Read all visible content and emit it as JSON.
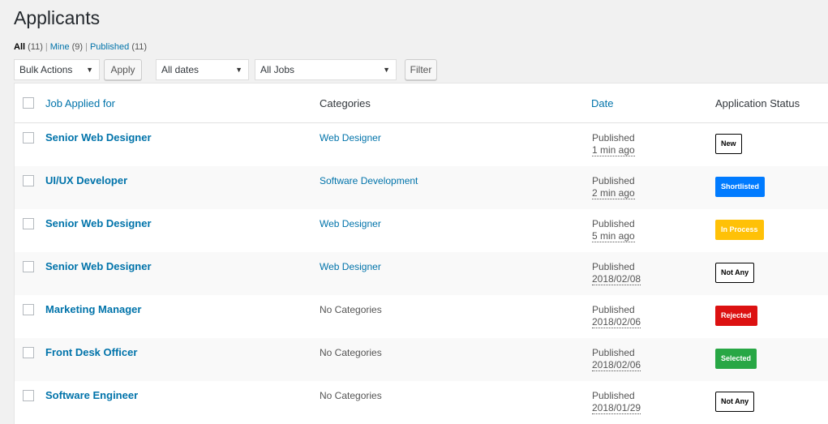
{
  "page": {
    "title": "Applicants"
  },
  "filters": {
    "all_label": "All",
    "all_count": "(11)",
    "mine_label": "Mine",
    "mine_count": "(9)",
    "published_label": "Published",
    "published_count": "(11)",
    "separator": "|"
  },
  "toolbar": {
    "bulk_actions": "Bulk Actions",
    "apply": "Apply",
    "dates": "All dates",
    "jobs": "All Jobs",
    "filter": "Filter",
    "arrow": "▼"
  },
  "columns": {
    "job": "Job Applied for",
    "categories": "Categories",
    "date": "Date",
    "status": "Application Status"
  },
  "rows": [
    {
      "job": "Senior Web Designer",
      "category": "Web Designer",
      "category_linked": true,
      "date_status": "Published",
      "date": "1 min ago",
      "status": "New",
      "status_style": "outline"
    },
    {
      "job": "UI/UX Developer",
      "category": "Software Development",
      "category_linked": true,
      "date_status": "Published",
      "date": "2 min ago",
      "status": "Shortlisted",
      "status_style": "blue"
    },
    {
      "job": "Senior Web Designer",
      "category": "Web Designer",
      "category_linked": true,
      "date_status": "Published",
      "date": "5 min ago",
      "status": "In Process",
      "status_style": "yellow"
    },
    {
      "job": "Senior Web Designer",
      "category": "Web Designer",
      "category_linked": true,
      "date_status": "Published",
      "date": "2018/02/08",
      "status": "Not Any",
      "status_style": "outline"
    },
    {
      "job": "Marketing Manager",
      "category": "No Categories",
      "category_linked": false,
      "date_status": "Published",
      "date": "2018/02/06",
      "status": "Rejected",
      "status_style": "red"
    },
    {
      "job": "Front Desk Officer",
      "category": "No Categories",
      "category_linked": false,
      "date_status": "Published",
      "date": "2018/02/06",
      "status": "Selected",
      "status_style": "green"
    },
    {
      "job": "Software Engineer",
      "category": "No Categories",
      "category_linked": false,
      "date_status": "Published",
      "date": "2018/01/29",
      "status": "Not Any",
      "status_style": "outline"
    }
  ],
  "colors": {
    "link": "#0073aa",
    "outline": "#000000",
    "blue": "#007bff",
    "yellow": "#ffc107",
    "red": "#dc1111",
    "green": "#28a745"
  }
}
